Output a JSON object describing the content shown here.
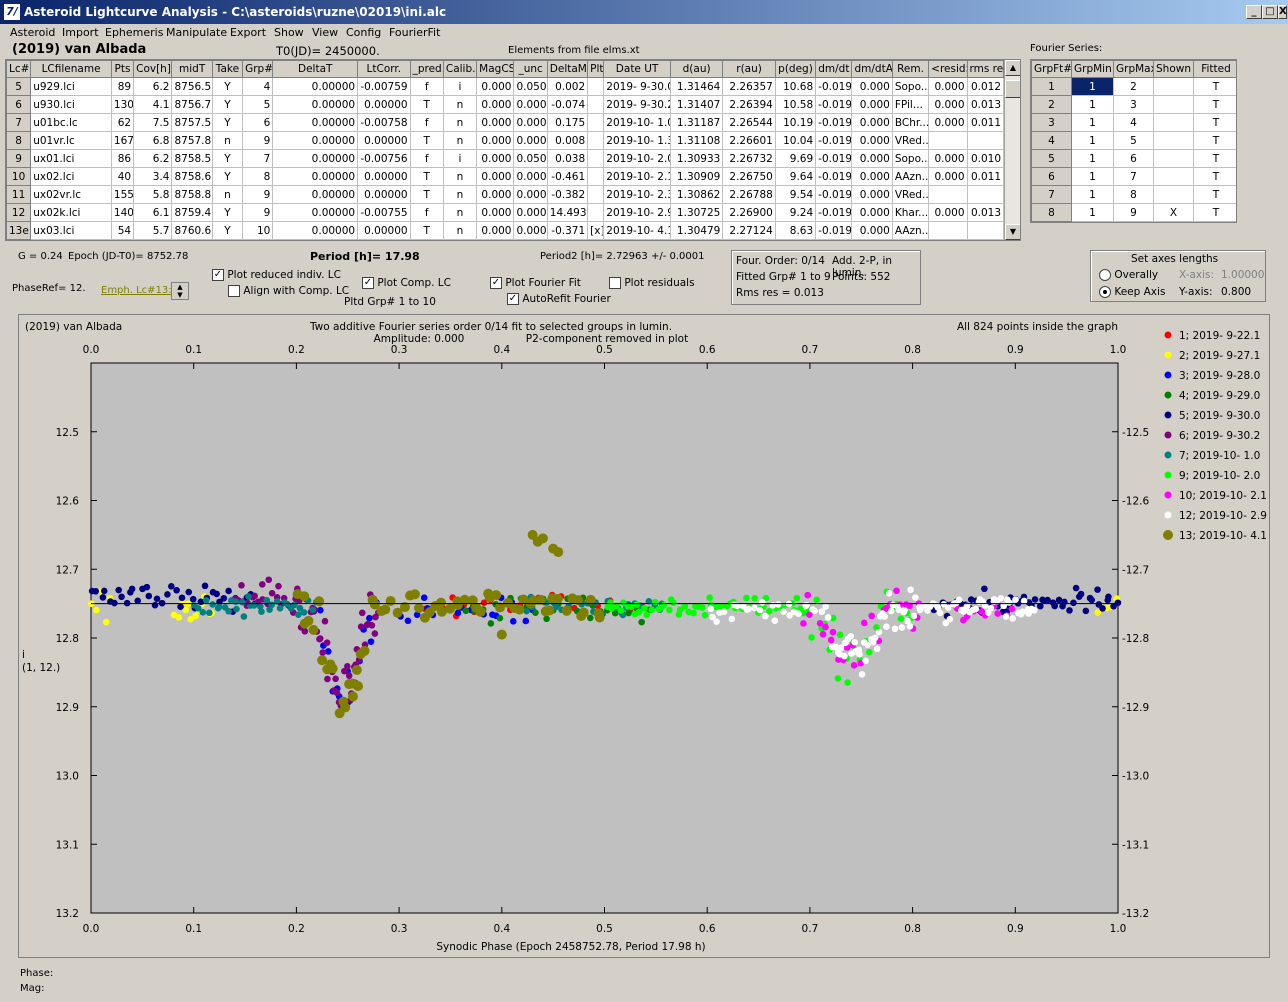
{
  "window": {
    "title": "Asteroid Lightcurve Analysis - C:\\asteroids\\ruzne\\02019\\ini.alc",
    "icon": "7/",
    "min": "_",
    "max": "□",
    "close": "X"
  },
  "menu": [
    "Asteroid",
    "Import",
    "Ephemeris",
    "Manipulate",
    "Export",
    "Show",
    "View",
    "Config",
    "FourierFit"
  ],
  "asteroid_name": "(2019) van Albada",
  "t0": "T0(JD)= 2450000.",
  "elements": "Elements from file elms.xt",
  "lc_table": {
    "headers": [
      "Lc#",
      "LCfilename",
      "Pts",
      "Cov[h]",
      "midT",
      "Take",
      "Grp#",
      "DeltaT",
      "LtCorr.",
      "_pred.",
      "Calib.",
      "MagCS",
      "_unc",
      "DeltaM",
      "Plt",
      "Date UT",
      "d(au)",
      "r(au)",
      "p(deg)",
      "dm/dt",
      "dm/dtA",
      "Rem.",
      "<resid>",
      "rms res"
    ],
    "rows": [
      [
        "5",
        "u929.lci",
        "89",
        "6.2",
        "8756.5",
        "Y",
        "4",
        "0.00000",
        "-0.00759",
        "f",
        "i",
        "0.000",
        "0.050",
        "0.002",
        "",
        "2019- 9-30.0",
        "1.31464",
        "2.26357",
        "10.68",
        "-0.019",
        "0.000",
        "Sopo...",
        "0.000",
        "0.012"
      ],
      [
        "6",
        "u930.lci",
        "130",
        "4.1",
        "8756.7",
        "Y",
        "5",
        "0.00000",
        "0.00000",
        "T",
        "n",
        "0.000",
        "0.000",
        "-0.074",
        "",
        "2019- 9-30.2",
        "1.31407",
        "2.26394",
        "10.58",
        "-0.019",
        "0.000",
        "FPil...",
        "0.000",
        "0.013"
      ],
      [
        "7",
        "u01bc.lc",
        "62",
        "7.5",
        "8757.5",
        "Y",
        "6",
        "0.00000",
        "-0.00758",
        "f",
        "n",
        "0.000",
        "0.000",
        "0.175",
        "",
        "2019-10- 1.0",
        "1.31187",
        "2.26544",
        "10.19",
        "-0.019",
        "0.000",
        "BChr...",
        "0.000",
        "0.011"
      ],
      [
        "8",
        "u01vr.lc",
        "167",
        "6.8",
        "8757.8",
        "n",
        "9",
        "0.00000",
        "0.00000",
        "T",
        "n",
        "0.000",
        "0.000",
        "0.008",
        "",
        "2019-10- 1.3",
        "1.31108",
        "2.26601",
        "10.04",
        "-0.019",
        "0.000",
        "VRed...",
        "",
        ""
      ],
      [
        "9",
        "ux01.lci",
        "86",
        "6.2",
        "8758.5",
        "Y",
        "7",
        "0.00000",
        "-0.00756",
        "f",
        "i",
        "0.000",
        "0.050",
        "0.038",
        "",
        "2019-10- 2.0",
        "1.30933",
        "2.26732",
        "9.69",
        "-0.019",
        "0.000",
        "Sopo...",
        "0.000",
        "0.010"
      ],
      [
        "10",
        "ux02.lci",
        "40",
        "3.4",
        "8758.6",
        "Y",
        "8",
        "0.00000",
        "0.00000",
        "T",
        "n",
        "0.000",
        "0.000",
        "-0.461",
        "",
        "2019-10- 2.1",
        "1.30909",
        "2.26750",
        "9.64",
        "-0.019",
        "0.000",
        "AAzn...",
        "0.000",
        "0.011"
      ],
      [
        "11",
        "ux02vr.lc",
        "155",
        "5.8",
        "8758.8",
        "n",
        "9",
        "0.00000",
        "0.00000",
        "T",
        "n",
        "0.000",
        "0.000",
        "-0.382",
        "",
        "2019-10- 2.3",
        "1.30862",
        "2.26788",
        "9.54",
        "-0.019",
        "0.000",
        "VRed...",
        "",
        ""
      ],
      [
        "12",
        "ux02k.lci",
        "140",
        "6.1",
        "8759.4",
        "Y",
        "9",
        "0.00000",
        "-0.00755",
        "f",
        "n",
        "0.000",
        "0.000",
        "14.493",
        "",
        "2019-10- 2.9",
        "1.30725",
        "2.26900",
        "9.24",
        "-0.019",
        "0.000",
        "Khar...",
        "0.000",
        "0.013"
      ],
      [
        "13e",
        "ux03.lci",
        "54",
        "5.7",
        "8760.6",
        "Y",
        "10",
        "0.00000",
        "0.00000",
        "T",
        "n",
        "0.000",
        "0.000",
        "-0.371",
        "[x]",
        "2019-10- 4.1",
        "1.30479",
        "2.27124",
        "8.63",
        "-0.019",
        "0.000",
        "AAzn...",
        "",
        ""
      ]
    ]
  },
  "fourier_label": "Fourier Series:",
  "fourier_table": {
    "headers": [
      "GrpFt#",
      "GrpMin",
      "GrpMax",
      "Shown",
      "Fitted"
    ],
    "rows": [
      [
        "1",
        "1",
        "2",
        "",
        "T"
      ],
      [
        "2",
        "1",
        "3",
        "",
        "T"
      ],
      [
        "3",
        "1",
        "4",
        "",
        "T"
      ],
      [
        "4",
        "1",
        "5",
        "",
        "T"
      ],
      [
        "5",
        "1",
        "6",
        "",
        "T"
      ],
      [
        "6",
        "1",
        "7",
        "",
        "T"
      ],
      [
        "7",
        "1",
        "8",
        "",
        "T"
      ],
      [
        "8",
        "1",
        "9",
        "X",
        "T"
      ]
    ]
  },
  "controls": {
    "g": "G = 0.24",
    "epoch": "Epoch (JD-T0)= 8752.78",
    "period": "Period [h]= 17.98",
    "period2": "Period2 [h]= 2.72963 +/- 0.0001",
    "phaseref": "PhaseRef= 12.",
    "emph": "Emph. Lc#13:",
    "plot_reduced": "Plot reduced indiv. LC",
    "align_comp": "Align with Comp. LC",
    "plot_comp": "Plot Comp. LC",
    "pltd_grp": "Pltd Grp#  1   to   10",
    "plot_fourier": "Plot Fourier Fit",
    "autorefit": "AutoRefit Fourier",
    "plot_resid": "Plot residuals",
    "check": "✓"
  },
  "fit_info": {
    "order": "Four. Order:  0/14",
    "add": "Add. 2-P, in lumin.",
    "fitted": "Fitted Grp# 1 to 9",
    "points": "Points: 552",
    "rms": "Rms res      = 0.013"
  },
  "axes_box": {
    "title": "Set axes lengths",
    "overally": "Overally",
    "keep": "Keep Axis",
    "xaxis_lbl": "X-axis:",
    "xaxis_val": "1.00000",
    "yaxis_lbl": "Y-axis:",
    "yaxis_val": "0.800"
  },
  "chart_data": {
    "type": "scatter",
    "title": "(2019) van Albada",
    "subtitle1": "Two additive Fourier series order 0/14 fit to selected groups in lumin.",
    "subtitle2": "Amplitude: 0.000",
    "subtitle3": "P2-component removed in plot",
    "note": "All 824 points inside the graph",
    "xlabel": "Synodic Phase (Epoch 2458752.78, Period 17.98 h)",
    "ylabel1": "i",
    "ylabel2": "(1, 12.)",
    "xlim": [
      0.0,
      1.0
    ],
    "ylim": [
      13.2,
      12.4
    ],
    "xticks": [
      "0.0",
      "0.1",
      "0.2",
      "0.3",
      "0.4",
      "0.5",
      "0.6",
      "0.7",
      "0.8",
      "0.9",
      "1.0"
    ],
    "yticks": [
      "12.5",
      "12.6",
      "12.7",
      "12.8",
      "12.9",
      "13.0",
      "13.1",
      "13.2"
    ],
    "fit_line": 12.75,
    "grid": false,
    "legend_position": "right",
    "series": [
      {
        "name": "1; 2019- 9-22.1",
        "color": "#ff0000",
        "segments": [
          [
            0.32,
            0.54,
            12.75,
            0.015,
            26
          ]
        ]
      },
      {
        "name": "2; 2019- 9-27.1",
        "color": "#ffff00",
        "segments": [
          [
            0.0,
            0.02,
            12.75,
            0.02,
            5
          ],
          [
            0.08,
            0.12,
            12.76,
            0.015,
            12
          ],
          [
            0.98,
            1.0,
            12.75,
            0.015,
            5
          ]
        ]
      },
      {
        "name": "3; 2019- 9-28.0",
        "color": "#0000ff",
        "segments": [
          [
            0.22,
            0.28,
            12.84,
            0.03,
            14
          ],
          [
            0.3,
            0.43,
            12.76,
            0.015,
            20
          ]
        ]
      },
      {
        "name": "4; 2019- 9-29.0",
        "color": "#008000",
        "segments": [
          [
            0.36,
            0.55,
            12.76,
            0.015,
            30
          ]
        ]
      },
      {
        "name": "5; 2019- 9-30.0",
        "color": "#000080",
        "segments": [
          [
            0.0,
            0.16,
            12.74,
            0.015,
            40
          ],
          [
            0.82,
            1.0,
            12.75,
            0.015,
            55
          ]
        ]
      },
      {
        "name": "6; 2019- 9-30.2",
        "color": "#800080",
        "segments": [
          [
            0.14,
            0.2,
            12.74,
            0.02,
            20
          ],
          [
            0.2,
            0.28,
            12.83,
            0.035,
            45
          ]
        ]
      },
      {
        "name": "7; 2019-10- 1.0",
        "color": "#008080",
        "segments": [
          [
            0.1,
            0.22,
            12.755,
            0.01,
            35
          ],
          [
            0.42,
            0.56,
            12.755,
            0.01,
            30
          ]
        ]
      },
      {
        "name": "9; 2019-10- 2.0",
        "color": "#00ff00",
        "segments": [
          [
            0.5,
            0.7,
            12.755,
            0.01,
            60
          ],
          [
            0.7,
            0.8,
            12.8,
            0.03,
            25
          ]
        ]
      },
      {
        "name": "10; 2019-10- 2.1",
        "color": "#ff00ff",
        "segments": [
          [
            0.69,
            0.81,
            12.81,
            0.03,
            30
          ],
          [
            0.84,
            0.9,
            12.76,
            0.01,
            10
          ]
        ]
      },
      {
        "name": "12; 2019-10- 2.9",
        "color": "#ffffff",
        "segments": [
          [
            0.6,
            0.72,
            12.76,
            0.012,
            30
          ],
          [
            0.72,
            0.8,
            12.81,
            0.025,
            40
          ],
          [
            0.8,
            0.92,
            12.755,
            0.015,
            50
          ]
        ]
      },
      {
        "name": "13; 2019-10- 4.1",
        "color": "#808000",
        "segments": [
          [
            0.2,
            0.27,
            12.82,
            0.035,
            18
          ],
          [
            0.27,
            0.5,
            12.75,
            0.015,
            45
          ]
        ],
        "extra": [
          [
            0.43,
            12.65
          ],
          [
            0.44,
            12.655
          ],
          [
            0.435,
            12.66
          ],
          [
            0.45,
            12.67
          ],
          [
            0.455,
            12.675
          ],
          [
            0.4,
            12.795
          ],
          [
            0.26,
            12.87
          ],
          [
            0.255,
            12.885
          ]
        ]
      }
    ]
  },
  "status": {
    "phase": "Phase:",
    "mag": "Mag:"
  }
}
